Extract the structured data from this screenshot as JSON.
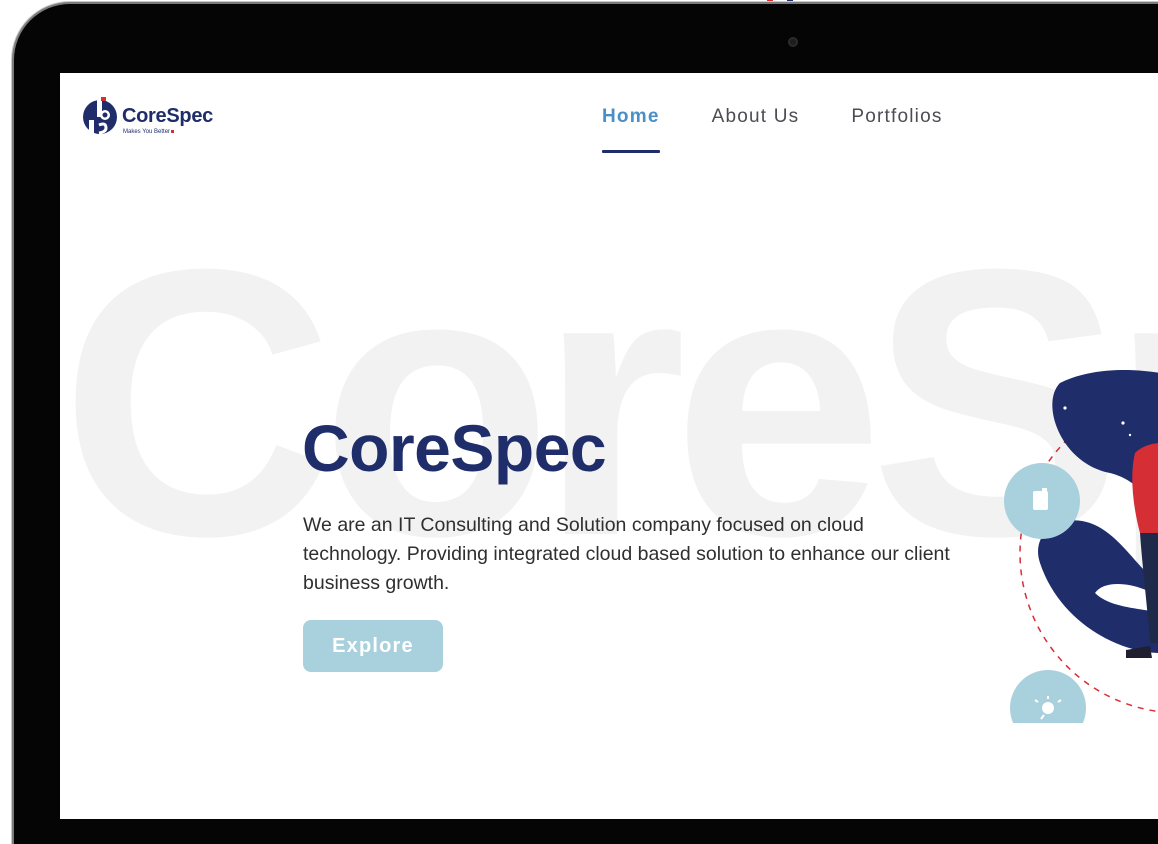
{
  "logo": {
    "name": "CoreSpec",
    "tagline": "Makes You Better"
  },
  "nav": {
    "items": [
      {
        "label": "Home",
        "active": true
      },
      {
        "label": "About Us",
        "active": false
      },
      {
        "label": "Portfolios",
        "active": false
      }
    ]
  },
  "hero": {
    "watermark": "CoreSpec",
    "title": "CoreSpec",
    "description": "We are an IT Consulting and Solution company focused on cloud technology. Providing integrated cloud based solution to enhance our client business growth.",
    "cta_label": "Explore"
  },
  "colors": {
    "brand_navy": "#1f2d6a",
    "nav_active": "#4a8fc8",
    "button": "#a9d0dd",
    "accent_red": "#d62e35"
  },
  "icons": [
    "document-icon",
    "lightbulb-icon"
  ]
}
